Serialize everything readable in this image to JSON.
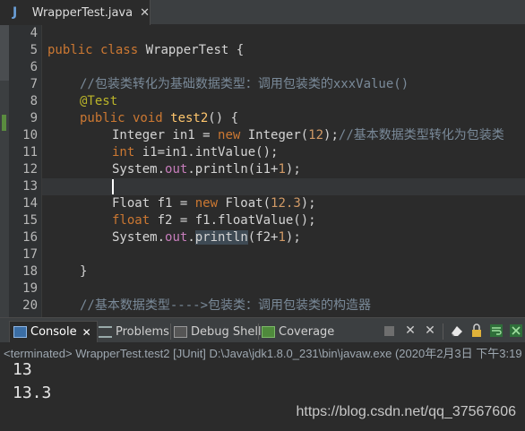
{
  "editor": {
    "tab": {
      "icon": "java-file-icon",
      "glyph": "J",
      "title": "WrapperTest.java",
      "close": "✕"
    },
    "line_numbers": [
      "4",
      "5",
      "6",
      "7",
      "8",
      "9",
      "10",
      "11",
      "12",
      "13",
      "14",
      "15",
      "16",
      "17",
      "18",
      "19",
      "20"
    ],
    "lines": {
      "l5": {
        "kw": "public class",
        "name": " WrapperTest {"
      },
      "l7": {
        "comment": "//包装类转化为基础数据类型：调用包装类的xxxValue()"
      },
      "l8": {
        "annotation": "@Test"
      },
      "l9": {
        "kw": "public void",
        "name": " test2",
        "rest": "() {"
      },
      "l10": {
        "a": "Integer in1 = ",
        "kw": "new",
        "b": " Integer(",
        "num": "12",
        "c": ");",
        "comment": "//基本数据类型转化为包装类"
      },
      "l11": {
        "kw": "int",
        "rest": " i1=in1.intValue();"
      },
      "l12": {
        "a": "System.",
        "field": "out",
        "b": ".println(i1+",
        "num": "1",
        "c": ");"
      },
      "l14": {
        "a": "Float f1 = ",
        "kw": "new",
        "b": " Float(",
        "num": "12.3",
        "c": ");"
      },
      "l15": {
        "kw": "float",
        "rest": " f2 = f1.floatValue();"
      },
      "l16": {
        "a": "System.",
        "field": "out",
        "dot": ".",
        "method": "println",
        "b": "(f2+",
        "num": "1",
        "c": ");"
      },
      "l18": {
        "text": "}"
      },
      "l20": {
        "comment": "//基本数据类型---->包装类：调用包装类的构造器"
      }
    }
  },
  "views": {
    "tabs": [
      {
        "label": "Console",
        "icon": "console-icon",
        "close": "✕"
      },
      {
        "label": "Problems",
        "icon": "problems-icon"
      },
      {
        "label": "Debug Shell",
        "icon": "debug-shell-icon"
      },
      {
        "label": "Coverage",
        "icon": "coverage-icon"
      }
    ],
    "toolbar": {
      "stop": "stop-icon",
      "remove": "✕",
      "remove_all": "✕",
      "clear": "clear-console-icon",
      "lock": "scroll-lock-icon",
      "wrap": "word-wrap-icon",
      "pin": "pin-console-icon"
    }
  },
  "console": {
    "header": "<terminated> WrapperTest.test2 [JUnit] D:\\Java\\jdk1.8.0_231\\bin\\javaw.exe (2020年2月3日 下午3:19",
    "output": [
      "13",
      "13.3"
    ],
    "watermark": "https://blog.csdn.net/qq_37567606"
  }
}
